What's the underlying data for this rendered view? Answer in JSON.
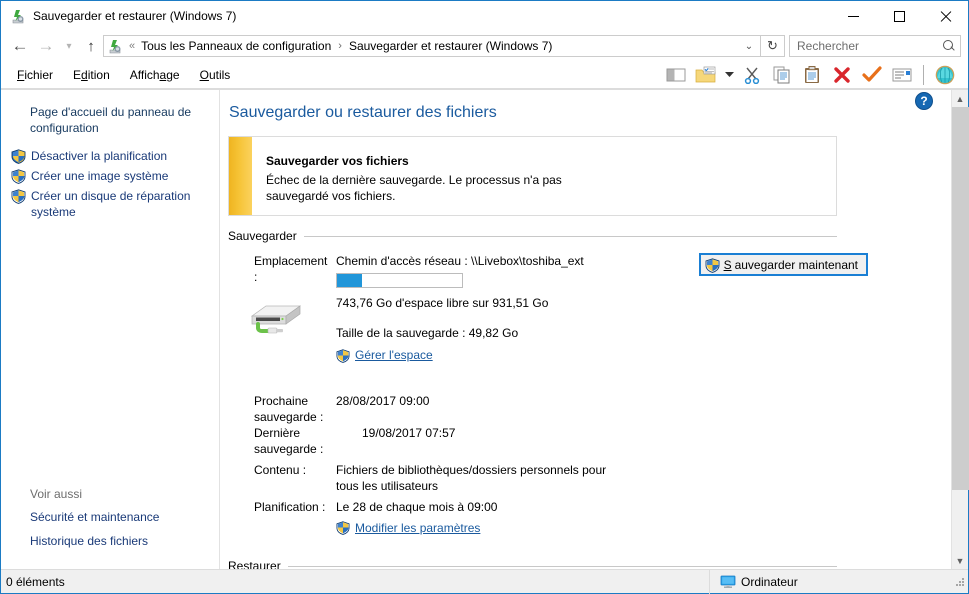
{
  "window": {
    "title": "Sauvegarder et restaurer (Windows 7)",
    "icon": "backup-restore-icon",
    "minimize_label": "Réduire",
    "maximize_label": "Agrandir",
    "close_label": "Fermer"
  },
  "addressbar": {
    "back_label": "Précédent",
    "forward_label": "Suivant",
    "recent_label": "Emplacements récents",
    "up_label": "Remonter d'un niveau",
    "overflow": "«",
    "crumbs": [
      "Tous les Panneaux de configuration",
      "Sauvegarder et restaurer (Windows 7)"
    ],
    "separator": "›",
    "dropdown": "⌄",
    "refresh": "↻",
    "search": {
      "placeholder": "Rechercher",
      "value": "",
      "icon": "search-icon"
    }
  },
  "menubar": {
    "items": [
      {
        "label": "Fichier",
        "accel": "F"
      },
      {
        "label": "Edition",
        "accel": "E"
      },
      {
        "label": "Affichage",
        "accel": "A"
      },
      {
        "label": "Outils",
        "accel": "O"
      }
    ],
    "toolbar_icons": [
      "preview-pane-icon",
      "folder-options-icon",
      "dropdown-arrow-icon",
      "cut-scissors-icon",
      "copy-icon",
      "paste-icon",
      "delete-red-x-icon",
      "validate-orange-check-icon",
      "properties-icon",
      "globe-shell-icon"
    ]
  },
  "sidebar": {
    "home_link": "Page d'accueil du panneau de configuration",
    "items": [
      {
        "label": "Désactiver la planification",
        "icon": "uac-shield-icon"
      },
      {
        "label": "Créer une image système",
        "icon": "uac-shield-icon"
      },
      {
        "label": "Créer un disque de réparation système",
        "icon": "uac-shield-icon"
      }
    ],
    "see_also_label": "Voir aussi",
    "see_also_items": [
      {
        "label": "Sécurité et maintenance"
      },
      {
        "label": "Historique des fichiers"
      }
    ]
  },
  "main": {
    "page_title": "Sauvegarder ou restaurer des fichiers",
    "alert": {
      "title": "Sauvegarder vos fichiers",
      "text": "Échec de la dernière sauvegarde. Le processus n'a pas sauvegardé vos fichiers.",
      "accent_color": "#f0b520"
    },
    "backup_section": {
      "heading": "Sauvegarder",
      "location_label": "Emplacement :",
      "location_value": "Chemin d'accès réseau : \\\\Livebox\\toshiba_ext",
      "drive_icon": "external-hard-drive-icon",
      "free_space_text": "743,76 Go d'espace libre sur 931,51 Go",
      "free_space_gb": 743.76,
      "total_space_gb": 931.51,
      "used_percent": 20,
      "backup_size_text": "Taille de la sauvegarde : 49,82 Go",
      "manage_space_link": "Gérer l'espace",
      "backup_now_button": "Sauvegarder maintenant",
      "backup_now_accel": "S",
      "next_backup_label": "Prochaine sauvegarde :",
      "next_backup_value": "28/08/2017 09:00",
      "last_backup_label": "Dernière sauvegarde :",
      "last_backup_value": "19/08/2017 07:57",
      "content_label": "Contenu :",
      "content_value": "Fichiers de bibliothèques/dossiers personnels pour tous les utilisateurs",
      "schedule_label": "Planification :",
      "schedule_value": "Le 28 de chaque mois à 09:00",
      "change_settings_link": "Modifier les paramètres"
    },
    "restore_section": {
      "heading": "Restaurer"
    },
    "help_badge": "?"
  },
  "statusbar": {
    "item_count": "0 éléments",
    "computer_label": "Ordinateur",
    "computer_icon": "computer-icon"
  }
}
